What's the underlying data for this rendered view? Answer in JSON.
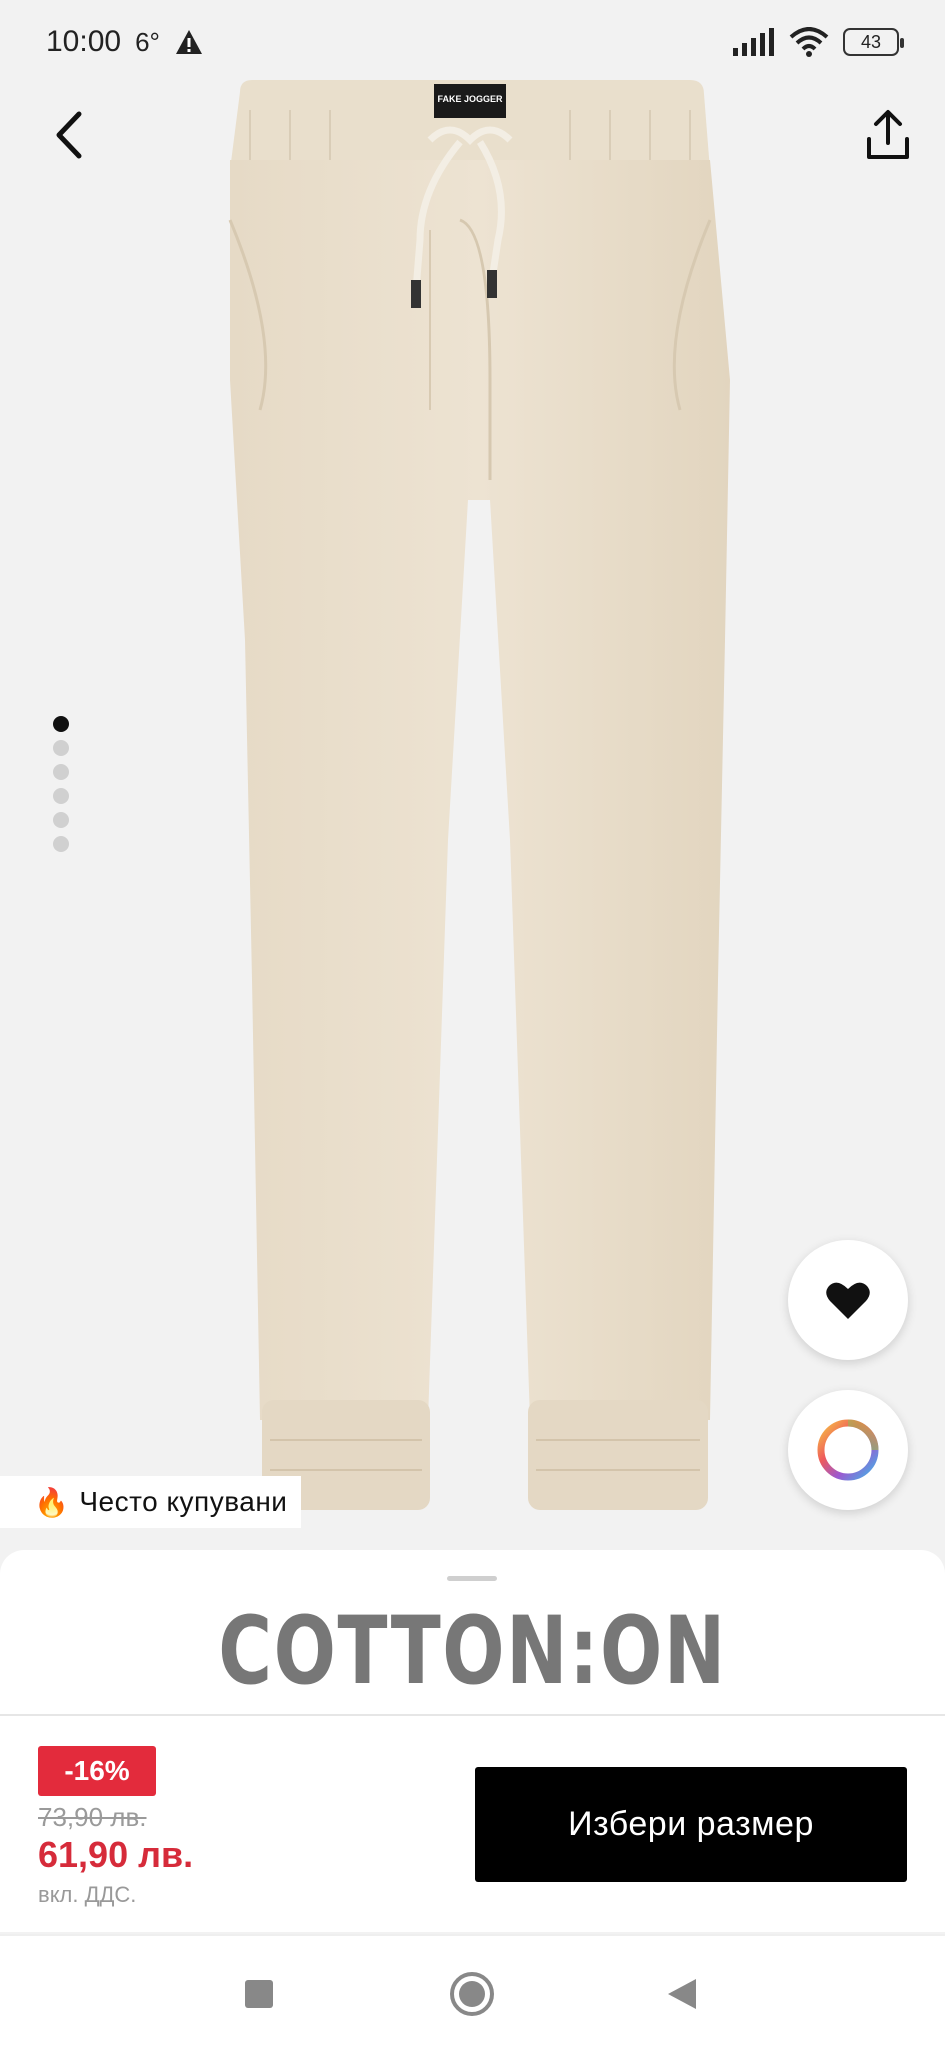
{
  "status_bar": {
    "time": "10:00",
    "temperature": "6°",
    "battery": "43"
  },
  "product": {
    "gallery_total_images": 6,
    "gallery_active_index": 0,
    "badge_text": "Често купувани",
    "waistband_label": "FAKE JOGGER",
    "brand": "COTTON:ON",
    "discount": "-16%",
    "old_price": "73,90 лв.",
    "new_price": "61,90 лв.",
    "vat_note": "вкл. ДДС.",
    "select_size_label": "Избери размер",
    "color": "#e8dcc8"
  },
  "icons": {
    "back": "chevron-left-icon",
    "share": "share-icon",
    "favorite": "heart-icon",
    "color_picker": "color-wheel-icon",
    "fire": "fire-icon"
  },
  "colors": {
    "accent_red": "#e32b3c",
    "price_red": "#d62b3a",
    "button_black": "#000000"
  }
}
